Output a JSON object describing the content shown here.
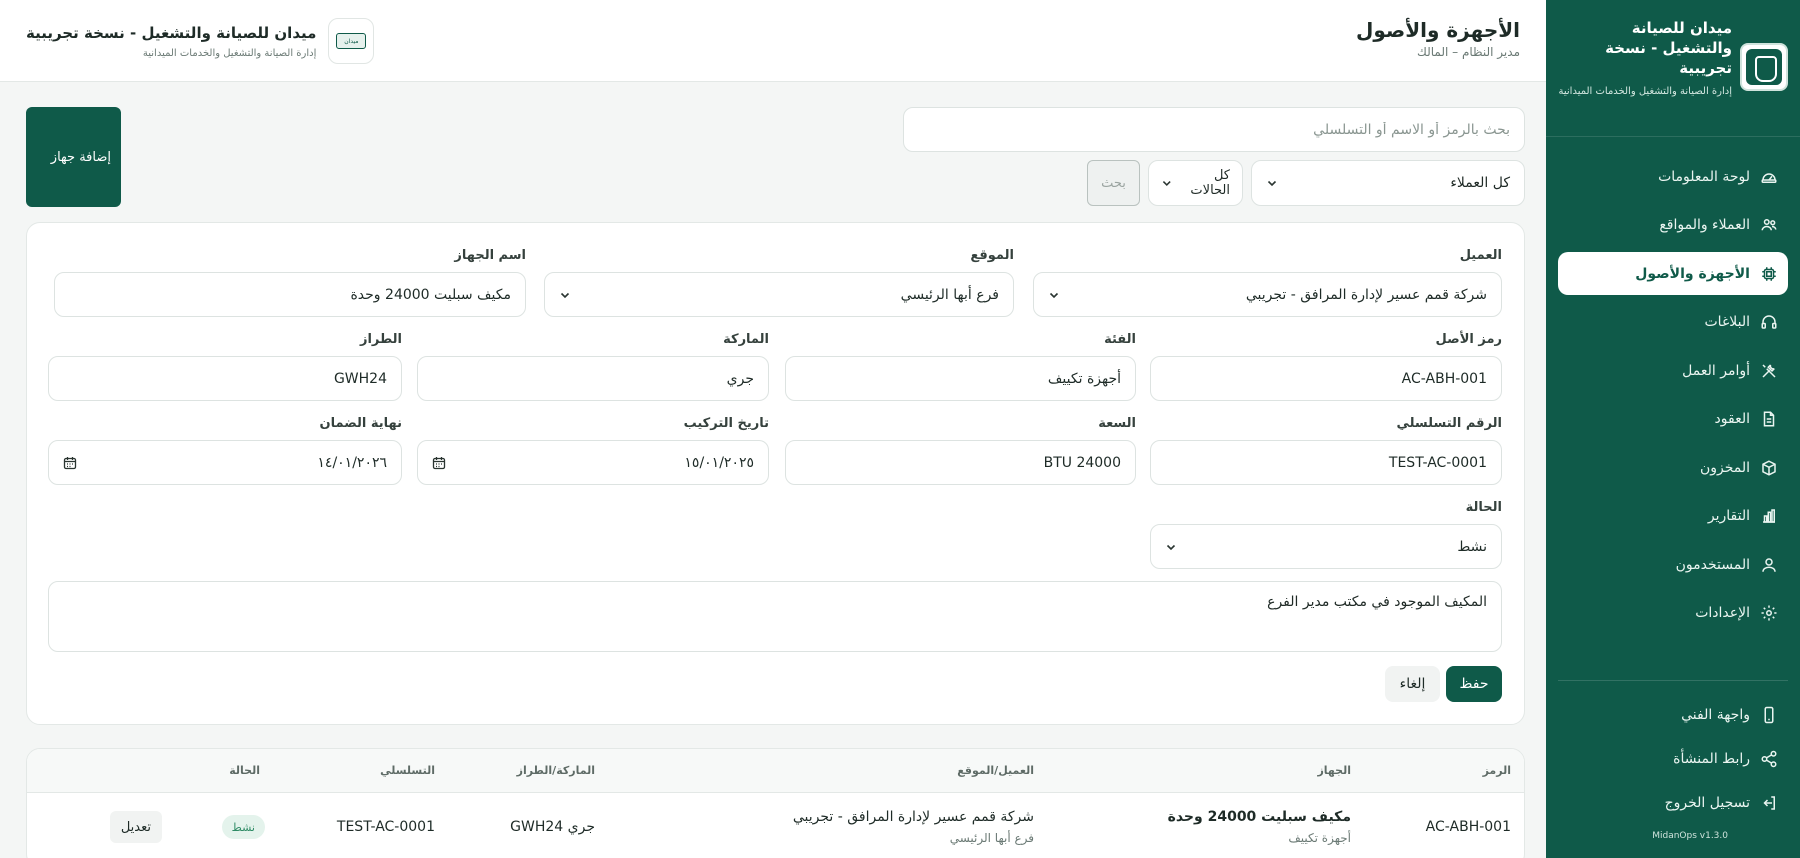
{
  "app": {
    "name": "ميدان للصيانة والتشغيل - نسخة تجريبية",
    "tagline": "إدارة الصيانة والتشغيل والخدمات الميدانية",
    "version": "MidanOps v1.3.0",
    "accent_color": "#0f5a49"
  },
  "sidebar": {
    "items": [
      {
        "label": "لوحة المعلومات",
        "icon": "dashboard-gauge-icon"
      },
      {
        "label": "العملاء والمواقع",
        "icon": "users-icon"
      },
      {
        "label": "الأجهزة والأصول",
        "icon": "chip-icon",
        "active": true
      },
      {
        "label": "البلاغات",
        "icon": "headset-icon"
      },
      {
        "label": "أوامر العمل",
        "icon": "tools-icon"
      },
      {
        "label": "العقود",
        "icon": "document-icon"
      },
      {
        "label": "المخزون",
        "icon": "box-icon"
      },
      {
        "label": "التقارير",
        "icon": "bar-chart-icon"
      },
      {
        "label": "المستخدمون",
        "icon": "user-icon"
      },
      {
        "label": "الإعدادات",
        "icon": "gear-icon"
      }
    ],
    "bottom_items": [
      {
        "label": "واجهة الفني",
        "icon": "phone-icon"
      },
      {
        "label": "رابط المنشأة",
        "icon": "share-icon"
      },
      {
        "label": "تسجيل الخروج",
        "icon": "logout-icon"
      }
    ]
  },
  "header": {
    "title": "الأجهزة والأصول",
    "subtitle": "مدير النظام – المالك",
    "org_title": "ميدان للصيانة والتشغيل - نسخة تجريبية",
    "org_subtitle": "إدارة الصيانة والتشغيل والخدمات الميدانية",
    "org_logo_text": "ميدان"
  },
  "toolbar": {
    "search_placeholder": "بحث بالرمز أو الاسم أو التسلسلي",
    "client_filter": "كل العملاء",
    "status_filter": "كل الحالات",
    "search_button": "بحث",
    "add_button": "إضافة جهاز"
  },
  "form": {
    "client": {
      "label": "العميل",
      "value": "شركة قمم عسير لإدارة المرافق - تجريبي"
    },
    "site": {
      "label": "الموقع",
      "value": "فرع أبها الرئيسي"
    },
    "device_name": {
      "label": "اسم الجهاز",
      "value": "مكيف سبليت 24000 وحدة"
    },
    "asset_code": {
      "label": "رمز الأصل",
      "value": "AC-ABH-001"
    },
    "category": {
      "label": "الفئة",
      "value": "أجهزة تكييف"
    },
    "brand": {
      "label": "الماركة",
      "value": "جري"
    },
    "model": {
      "label": "الطراز",
      "value": "GWH24"
    },
    "serial": {
      "label": "الرقم التسلسلي",
      "value": "TEST-AC-0001"
    },
    "capacity": {
      "label": "السعة",
      "value": "BTU 24000"
    },
    "install_date": {
      "label": "تاريخ التركيب",
      "value": "١٥/٠١/٢٠٢٥"
    },
    "warranty_end": {
      "label": "نهاية الضمان",
      "value": "١٤/٠١/٢٠٢٦"
    },
    "status": {
      "label": "الحالة",
      "value": "نشط"
    },
    "notes": "المكيف الموجود في مكتب مدير الفرع",
    "save_button": "حفظ",
    "cancel_button": "إلغاء"
  },
  "table": {
    "columns": [
      "الرمز",
      "الجهاز",
      "العميل/الموقع",
      "الماركة/الطراز",
      "التسلسلي",
      "الحالة"
    ],
    "rows": [
      {
        "code": "AC-ABH-001",
        "device": "مكيف سبليت 24000 وحدة",
        "category": "أجهزة تكييف",
        "client": "شركة قمم عسير لإدارة المرافق - تجريبي",
        "site": "فرع أبها الرئيسي",
        "brand_model": "جري GWH24",
        "serial": "TEST-AC-0001",
        "status": "نشط",
        "edit": "تعديل"
      }
    ]
  }
}
